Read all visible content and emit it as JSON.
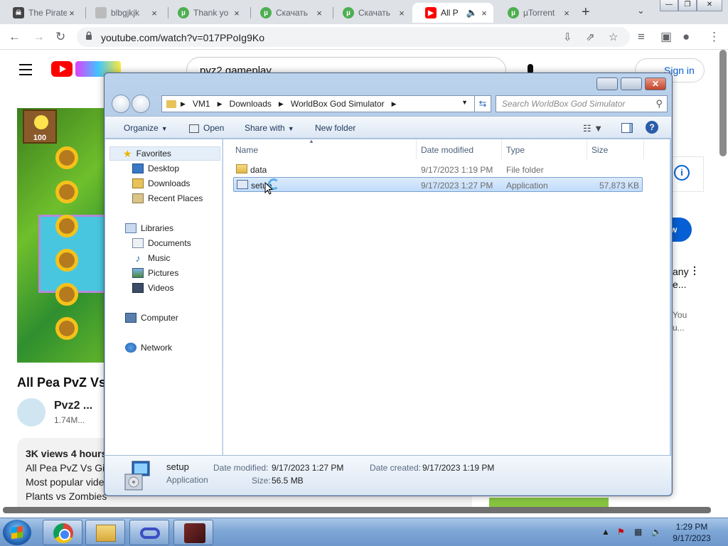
{
  "browser": {
    "tabs": [
      {
        "label": "The Pirate",
        "icon": "pirate-icon"
      },
      {
        "label": "blbgjkjk",
        "icon": "page-icon"
      },
      {
        "label": "Thank yo",
        "icon": "utorrent-icon"
      },
      {
        "label": "Скачать",
        "icon": "utorrent-icon"
      },
      {
        "label": "Скачать",
        "icon": "utorrent-icon"
      },
      {
        "label": "All P",
        "icon": "youtube-icon"
      },
      {
        "label": "µTorrent",
        "icon": "utorrent-icon"
      }
    ],
    "url": "youtube.com/watch?v=017PPoIg9Ko"
  },
  "youtube": {
    "search_query": "pvz2 gameplay",
    "sign_in": "Sign in",
    "seed_cost": "100",
    "video_title": "All Pea PvZ Vs",
    "channel_name": "Pvz2 ...",
    "channel_subs": "1.74M...",
    "desc_meta": "3K views  4 hours",
    "desc_lines": [
      "All Pea PvZ Vs Gi",
      "Most popular vide",
      "Plants vs Zombies"
    ],
    "side": {
      "subscribe_partial": "w",
      "text1": "any",
      "text2": "e...",
      "grey1": "You",
      "grey2": "u..."
    }
  },
  "explorer": {
    "breadcrumb": [
      "VM1",
      "Downloads",
      "WorldBox God Simulator"
    ],
    "search_placeholder": "Search WorldBox God Simulator",
    "commands": {
      "organize": "Organize",
      "open": "Open",
      "share_with": "Share with",
      "new_folder": "New folder"
    },
    "nav": {
      "favorites": "Favorites",
      "favorites_items": [
        "Desktop",
        "Downloads",
        "Recent Places"
      ],
      "libraries": "Libraries",
      "libraries_items": [
        "Documents",
        "Music",
        "Pictures",
        "Videos"
      ],
      "computer": "Computer",
      "network": "Network"
    },
    "columns": {
      "name": "Name",
      "date": "Date modified",
      "type": "Type",
      "size": "Size"
    },
    "files": [
      {
        "name": "data",
        "date": "9/17/2023 1:19 PM",
        "type": "File folder",
        "size": ""
      },
      {
        "name": "setup",
        "date": "9/17/2023 1:27 PM",
        "type": "Application",
        "size": "57,873 KB"
      }
    ],
    "details": {
      "name": "setup",
      "type": "Application",
      "modified_label": "Date modified:",
      "modified": "9/17/2023 1:27 PM",
      "created_label": "Date created:",
      "created": "9/17/2023 1:19 PM",
      "size_label": "Size:",
      "size": "56.5 MB"
    }
  },
  "taskbar": {
    "time": "1:29 PM",
    "date": "9/17/2023"
  }
}
